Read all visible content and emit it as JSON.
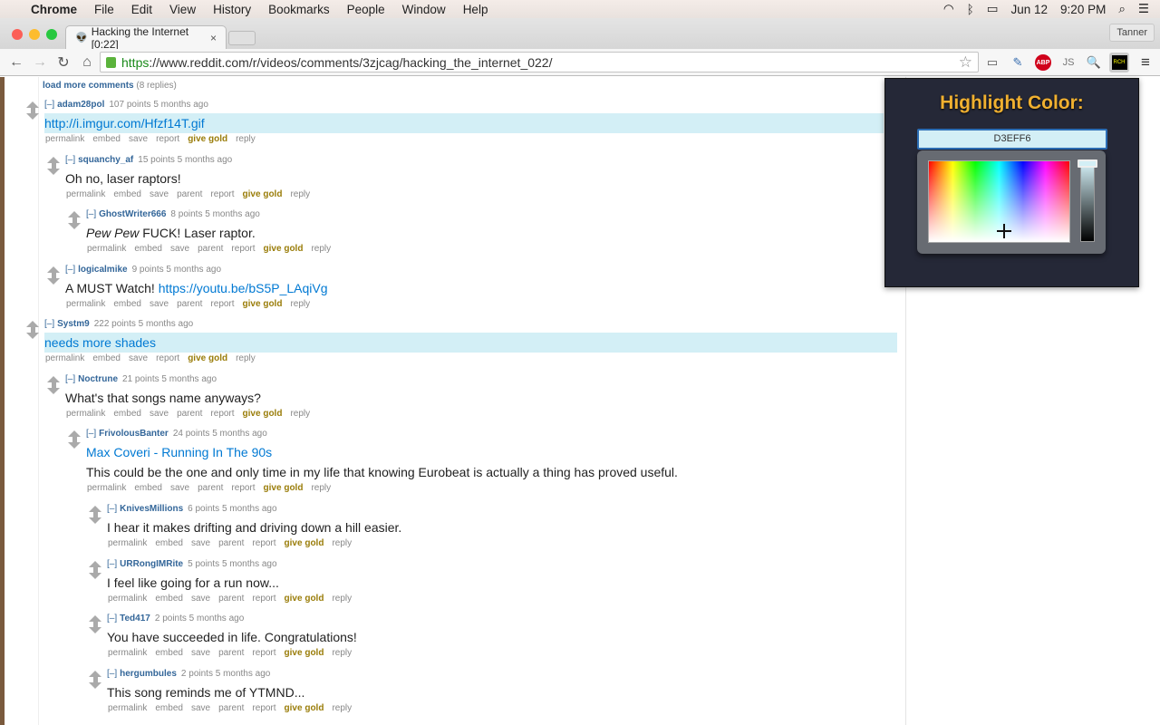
{
  "menubar": {
    "app": "Chrome",
    "items": [
      "File",
      "Edit",
      "View",
      "History",
      "Bookmarks",
      "People",
      "Window",
      "Help"
    ],
    "date": "Jun 12",
    "time": "9:20 PM"
  },
  "browser": {
    "tab_title": "Hacking the Internet [0:22]",
    "profile": "Tanner",
    "url_scheme": "https",
    "url_rest": "://www.reddit.com/r/videos/comments/3zjcag/hacking_the_internet_022/",
    "extensions": [
      "cast-icon",
      "eyedropper-icon",
      "adblock-plus-icon",
      "js-icon",
      "search-extension-icon",
      "rch-extension-icon"
    ],
    "abp_label": "ABP",
    "rch_label": "RCH"
  },
  "load_more": {
    "label": "load more comments",
    "count": "(8 replies)"
  },
  "collapse_label": "[–]",
  "comments": [
    {
      "depth": 0,
      "user": "adam28pol",
      "points": "107 points",
      "age": "5 months ago",
      "highlighted": true,
      "body": [
        {
          "type": "link",
          "text": "http://i.imgur.com/Hfzf14T.gif"
        }
      ],
      "actions": [
        "permalink",
        "embed",
        "save",
        "report",
        "give gold",
        "reply"
      ]
    },
    {
      "depth": 1,
      "user": "squanchy_af",
      "points": "15 points",
      "age": "5 months ago",
      "body": [
        {
          "type": "text",
          "text": "Oh no, laser raptors!"
        }
      ],
      "actions": [
        "permalink",
        "embed",
        "save",
        "parent",
        "report",
        "give gold",
        "reply"
      ]
    },
    {
      "depth": 2,
      "user": "GhostWriter666",
      "points": "8 points",
      "age": "5 months ago",
      "body": [
        {
          "type": "italic",
          "text": "Pew Pew"
        },
        {
          "type": "text",
          "text": " FUCK! Laser raptor."
        }
      ],
      "actions": [
        "permalink",
        "embed",
        "save",
        "parent",
        "report",
        "give gold",
        "reply"
      ]
    },
    {
      "depth": 1,
      "user": "logicalmike",
      "points": "9 points",
      "age": "5 months ago",
      "body": [
        {
          "type": "text",
          "text": "A MUST Watch! "
        },
        {
          "type": "link",
          "text": "https://youtu.be/bS5P_LAqiVg"
        }
      ],
      "actions": [
        "permalink",
        "embed",
        "save",
        "parent",
        "report",
        "give gold",
        "reply"
      ]
    },
    {
      "depth": 0,
      "user": "Systm9",
      "points": "222 points",
      "age": "5 months ago",
      "highlighted": true,
      "body": [
        {
          "type": "link",
          "text": "needs more shades"
        }
      ],
      "actions": [
        "permalink",
        "embed",
        "save",
        "report",
        "give gold",
        "reply"
      ]
    },
    {
      "depth": 1,
      "user": "Noctrune",
      "points": "21 points",
      "age": "5 months ago",
      "body": [
        {
          "type": "text",
          "text": "What's that songs name anyways?"
        }
      ],
      "actions": [
        "permalink",
        "embed",
        "save",
        "parent",
        "report",
        "give gold",
        "reply"
      ]
    },
    {
      "depth": 2,
      "user": "FrivolousBanter",
      "points": "24 points",
      "age": "5 months ago",
      "body": [
        {
          "type": "link",
          "text": "Max Coveri - Running In The 90s"
        }
      ],
      "body2": "This could be the one and only time in my life that knowing Eurobeat is actually a thing has proved useful.",
      "actions": [
        "permalink",
        "embed",
        "save",
        "parent",
        "report",
        "give gold",
        "reply"
      ]
    },
    {
      "depth": 3,
      "user": "KnivesMillions",
      "points": "6 points",
      "age": "5 months ago",
      "body": [
        {
          "type": "text",
          "text": "I hear it makes drifting and driving down a hill easier."
        }
      ],
      "actions": [
        "permalink",
        "embed",
        "save",
        "parent",
        "report",
        "give gold",
        "reply"
      ]
    },
    {
      "depth": 3,
      "user": "URRongIMRite",
      "points": "5 points",
      "age": "5 months ago",
      "body": [
        {
          "type": "text",
          "text": "I feel like going for a run now..."
        }
      ],
      "actions": [
        "permalink",
        "embed",
        "save",
        "parent",
        "report",
        "give gold",
        "reply"
      ]
    },
    {
      "depth": 3,
      "user": "Ted417",
      "points": "2 points",
      "age": "5 months ago",
      "body": [
        {
          "type": "text",
          "text": "You have succeeded in life. Congratulations!"
        }
      ],
      "actions": [
        "permalink",
        "embed",
        "save",
        "parent",
        "report",
        "give gold",
        "reply"
      ]
    },
    {
      "depth": 3,
      "user": "hergumbules",
      "points": "2 points",
      "age": "5 months ago",
      "body": [
        {
          "type": "text",
          "text": "This song reminds me of YTMND..."
        }
      ],
      "actions": [
        "permalink",
        "embed",
        "save",
        "parent",
        "report",
        "give gold",
        "reply"
      ]
    }
  ],
  "popup": {
    "title": "Highlight Color:",
    "hex_value": "D3EFF6",
    "highlight_color": "#D3EFF6",
    "title_color": "#F0B030"
  },
  "colors": {
    "username": "#336699",
    "link": "#0079D3",
    "gold": "#9A7D0A"
  }
}
